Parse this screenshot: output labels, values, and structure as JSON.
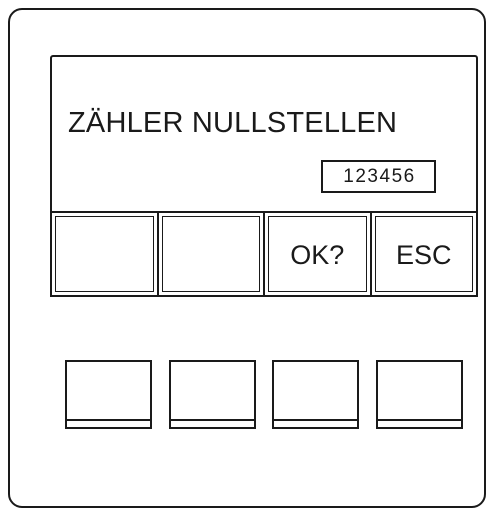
{
  "display": {
    "message": "ZÄHLER NULLSTELLEN",
    "counter_value": "123456"
  },
  "soft_keys": [
    {
      "label": ""
    },
    {
      "label": ""
    },
    {
      "label": "OK?"
    },
    {
      "label": "ESC"
    }
  ],
  "hardware_keys": [
    {
      "label": ""
    },
    {
      "label": ""
    },
    {
      "label": ""
    },
    {
      "label": ""
    }
  ]
}
